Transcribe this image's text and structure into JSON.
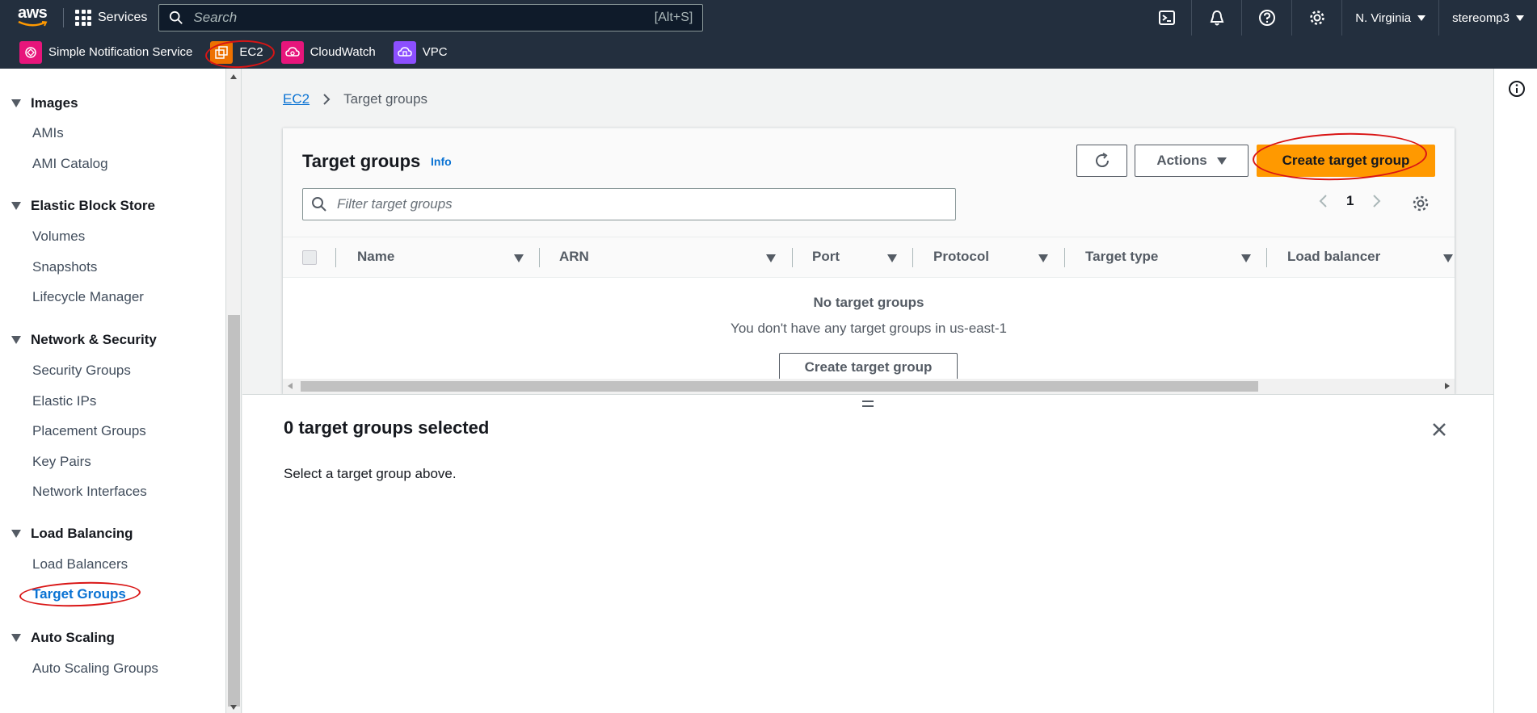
{
  "topbar": {
    "logo_text": "aws",
    "services_label": "Services",
    "search_placeholder": "Search",
    "search_shortcut": "[Alt+S]",
    "region": "N. Virginia",
    "user": "stereomp3"
  },
  "favorites": [
    {
      "label": "Simple Notification Service",
      "color": "#e7157b"
    },
    {
      "label": "EC2",
      "color": "#ed7100"
    },
    {
      "label": "CloudWatch",
      "color": "#e7157b"
    },
    {
      "label": "VPC",
      "color": "#8c4fff"
    }
  ],
  "sidebar": {
    "sections": [
      {
        "title": "Images",
        "items": [
          "AMIs",
          "AMI Catalog"
        ]
      },
      {
        "title": "Elastic Block Store",
        "items": [
          "Volumes",
          "Snapshots",
          "Lifecycle Manager"
        ]
      },
      {
        "title": "Network & Security",
        "items": [
          "Security Groups",
          "Elastic IPs",
          "Placement Groups",
          "Key Pairs",
          "Network Interfaces"
        ]
      },
      {
        "title": "Load Balancing",
        "items": [
          "Load Balancers",
          "Target Groups"
        ]
      },
      {
        "title": "Auto Scaling",
        "items": [
          "Auto Scaling Groups"
        ]
      }
    ],
    "active_item": "Target Groups"
  },
  "breadcrumb": {
    "root": "EC2",
    "current": "Target groups"
  },
  "panel": {
    "title": "Target groups",
    "info": "Info",
    "actions_label": "Actions",
    "create_label": "Create target group",
    "filter_placeholder": "Filter target groups",
    "page_number": "1",
    "columns": [
      "Name",
      "ARN",
      "Port",
      "Protocol",
      "Target type",
      "Load balancer"
    ],
    "empty_title": "No target groups",
    "empty_desc": "You don't have any target groups in us-east-1",
    "empty_button": "Create target group"
  },
  "split_panel": {
    "title": "0 target groups selected",
    "text": "Select a target group above."
  },
  "colors": {
    "nav_bg": "#232f3e",
    "primary": "#ff9900",
    "link": "#0972d3",
    "annotation": "#d91515"
  }
}
